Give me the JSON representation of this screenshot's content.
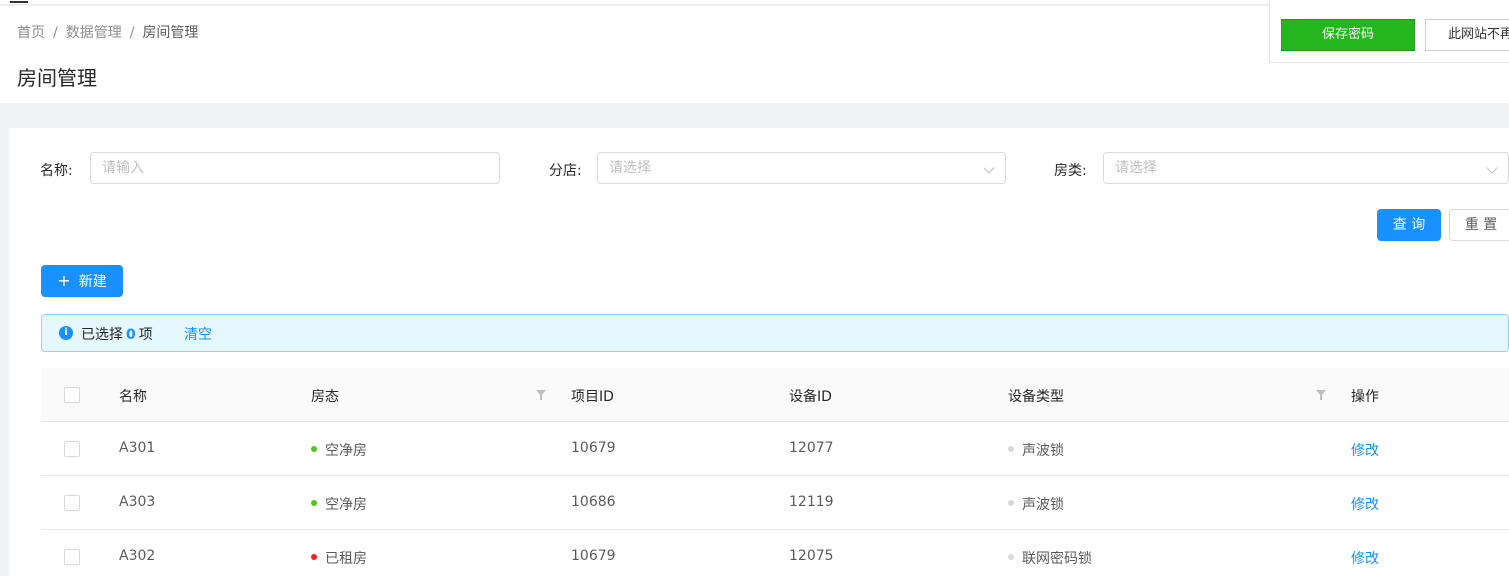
{
  "breadcrumb": {
    "items": [
      "首页",
      "数据管理",
      "房间管理"
    ],
    "separator": "/"
  },
  "page": {
    "title": "房间管理"
  },
  "search_form": {
    "name_label": "名称:",
    "name_placeholder": "请输入",
    "branch_label": "分店:",
    "branch_placeholder": "请选择",
    "room_type_label": "房类:",
    "room_type_placeholder": "请选择",
    "query_button": "查 询",
    "reset_button": "重 置"
  },
  "toolbar": {
    "new_button": "新建"
  },
  "selection_alert": {
    "prefix": "已选择",
    "count": "0",
    "suffix": "项",
    "clear_link": "清空"
  },
  "table": {
    "columns": [
      "名称",
      "房态",
      "项目ID",
      "设备ID",
      "设备类型",
      "操作"
    ],
    "rows": [
      {
        "name": "A301",
        "status": "空净房",
        "status_color": "#52c41a",
        "project_id": "10679",
        "device_id": "12077",
        "device_type": "声波锁",
        "action": "修改"
      },
      {
        "name": "A303",
        "status": "空净房",
        "status_color": "#52c41a",
        "project_id": "10686",
        "device_id": "12119",
        "device_type": "声波锁",
        "action": "修改"
      },
      {
        "name": "A302",
        "status": "已租房",
        "status_color": "#f5222d",
        "project_id": "10679",
        "device_id": "12075",
        "device_type": "联网密码锁",
        "action": "修改"
      }
    ]
  },
  "password_popup": {
    "save_button": "保存密码",
    "never_button": "此网站不再"
  },
  "colors": {
    "primary": "#1890ff",
    "save_green": "#23b61d",
    "success_dot": "#52c41a",
    "error_dot": "#f5222d",
    "device_dot": "#d9d9d9"
  }
}
